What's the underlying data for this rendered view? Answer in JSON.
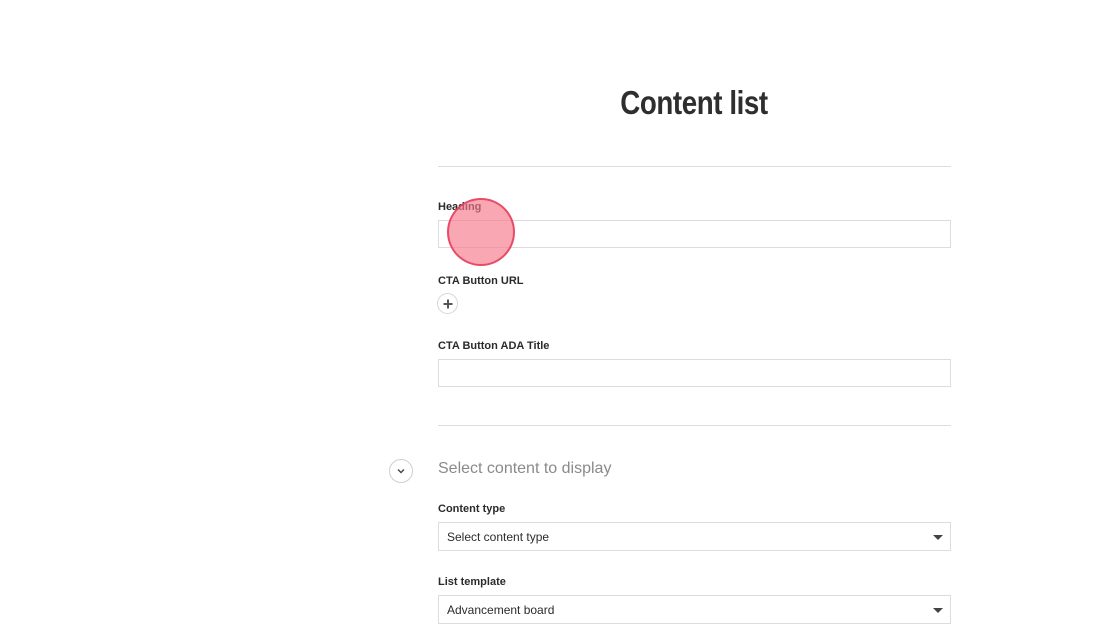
{
  "page": {
    "title": "Content list"
  },
  "fields": {
    "heading": {
      "label": "Heading",
      "value": "",
      "placeholder": ""
    },
    "cta_url": {
      "label": "CTA Button URL",
      "add_icon": "plus-icon"
    },
    "cta_ada_title": {
      "label": "CTA Button ADA Title",
      "value": "",
      "placeholder": ""
    }
  },
  "content_section": {
    "toggle_icon": "chevron-down-icon",
    "title": "Select content to display",
    "content_type": {
      "label": "Content type",
      "selected": "Select content type"
    },
    "list_template": {
      "label": "List template",
      "selected": "Advancement board"
    }
  },
  "colors": {
    "cursor_fill": "#f8788c",
    "cursor_stroke": "#e43c5a",
    "divider": "#dcdcdc"
  }
}
